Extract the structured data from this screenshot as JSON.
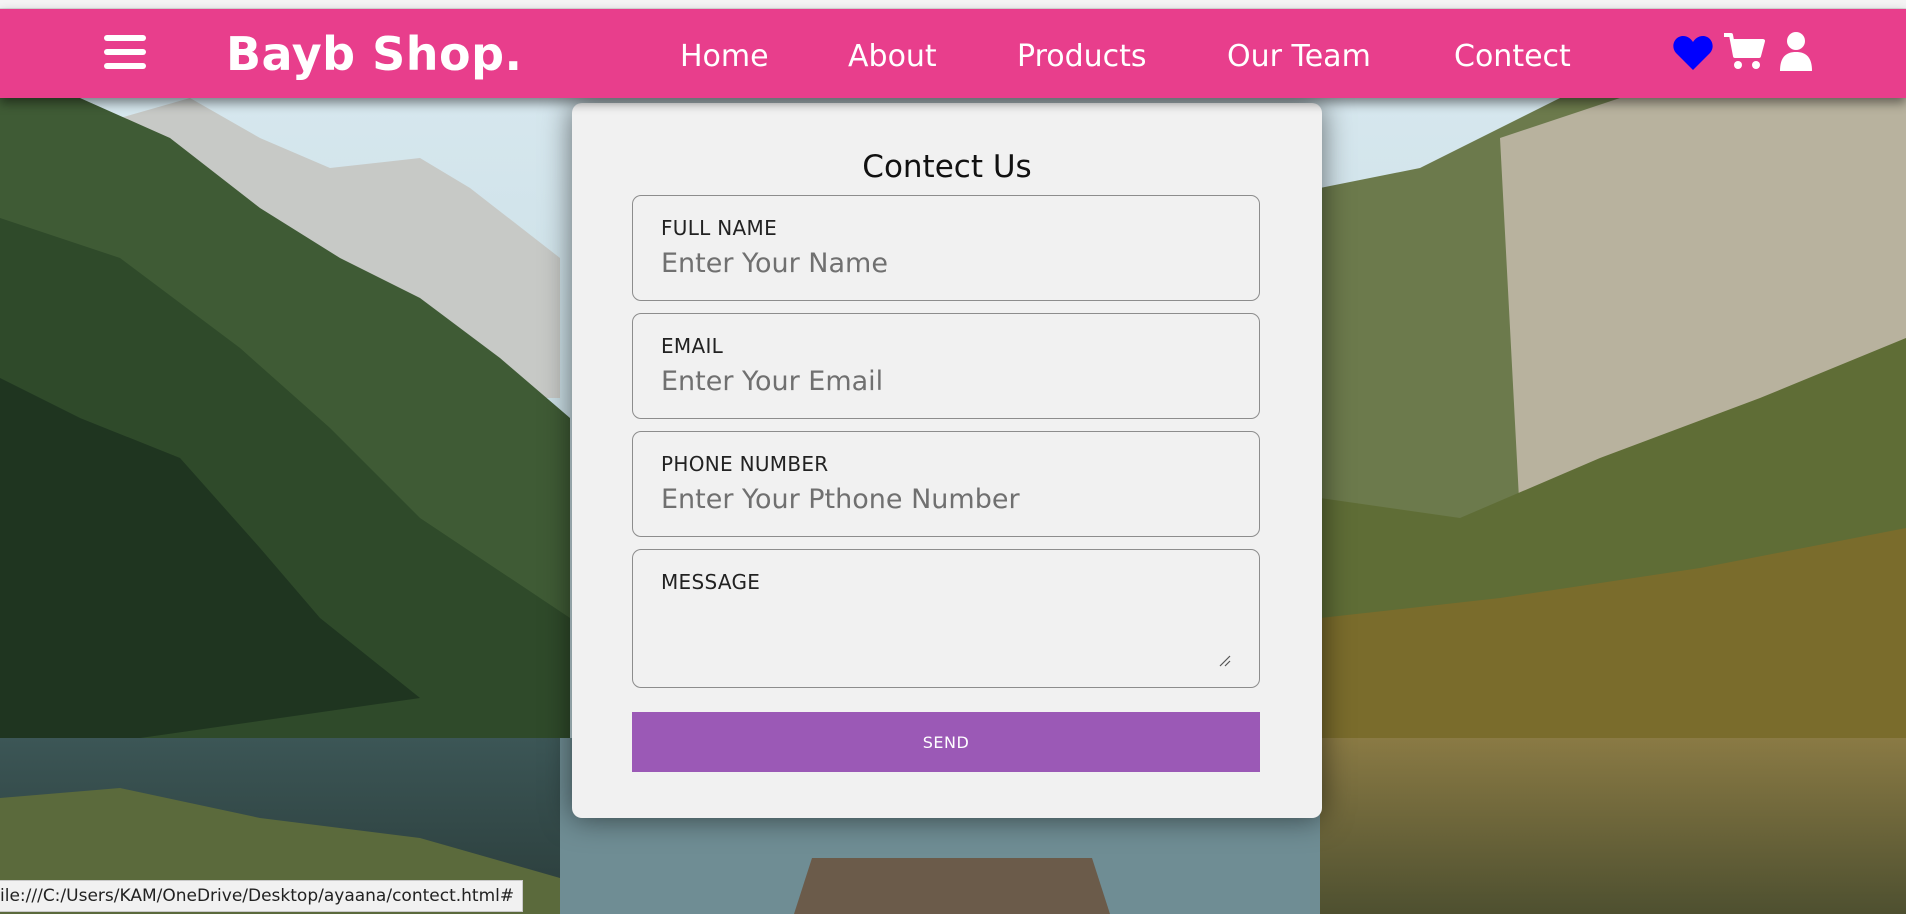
{
  "brand": {
    "name": "Bayb Shop.",
    "color": "#e83e8c"
  },
  "nav": {
    "links": [
      {
        "label": "Home"
      },
      {
        "label": "About"
      },
      {
        "label": "Products"
      },
      {
        "label": "Our Team"
      },
      {
        "label": "Contect"
      }
    ],
    "icons": [
      "menu-icon",
      "heart-icon",
      "cart-icon",
      "user-icon"
    ],
    "heart_color": "#0000ff"
  },
  "form": {
    "title": "Contect Us",
    "fields": [
      {
        "label": "FULL NAME",
        "placeholder": "Enter Your Name"
      },
      {
        "label": "EMAIL",
        "placeholder": "Enter Your Email"
      },
      {
        "label": "PHONE NUMBER",
        "placeholder": "Enter Your Pthone Number"
      },
      {
        "label": "MESSAGE",
        "placeholder": ""
      }
    ],
    "send_label": "SEND",
    "button_color": "#9b59b6"
  },
  "status": {
    "url": "ile:///C:/Users/KAM/OneDrive/Desktop/ayaana/contect.html#"
  }
}
